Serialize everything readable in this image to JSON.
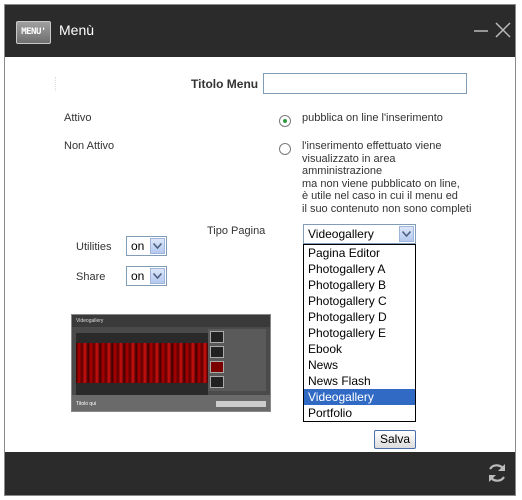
{
  "window": {
    "badge_text": "MENU'",
    "title": "Menù"
  },
  "form": {
    "titolo_label": "Titolo Menu",
    "titolo_value": "",
    "attivo_label": "Attivo",
    "attivo_desc": "pubblica on line l'inserimento",
    "non_attivo_label": "Non Attivo",
    "non_attivo_desc_lines": [
      "l'inserimento effettuato viene",
      "visualizzato in area",
      "amministrazione",
      "ma non viene pubblicato on line,",
      "è utile nel caso in cui il menu ed",
      "il suo contenuto non sono completi"
    ],
    "tipo_pagina_label": "Tipo Pagina",
    "tipo_pagina_value": "Videogallery",
    "tipo_pagina_options": [
      "Pagina Editor",
      "Photogallery A",
      "Photogallery B",
      "Photogallery C",
      "Photogallery D",
      "Photogallery E",
      "Ebook",
      "News",
      "News Flash",
      "Videogallery",
      "Portfolio"
    ],
    "tipo_pagina_selected_index": 9,
    "utilities_label": "Utilities",
    "utilities_value": "on",
    "share_label": "Share",
    "share_value": "on",
    "save_label": "Salva"
  },
  "preview": {
    "header_text": "Videogallery",
    "caption": "Titolo qui"
  },
  "colors": {
    "titlebar": "#2b2b2b",
    "selection": "#316ac5",
    "radio_on": "#2e9a3f"
  }
}
